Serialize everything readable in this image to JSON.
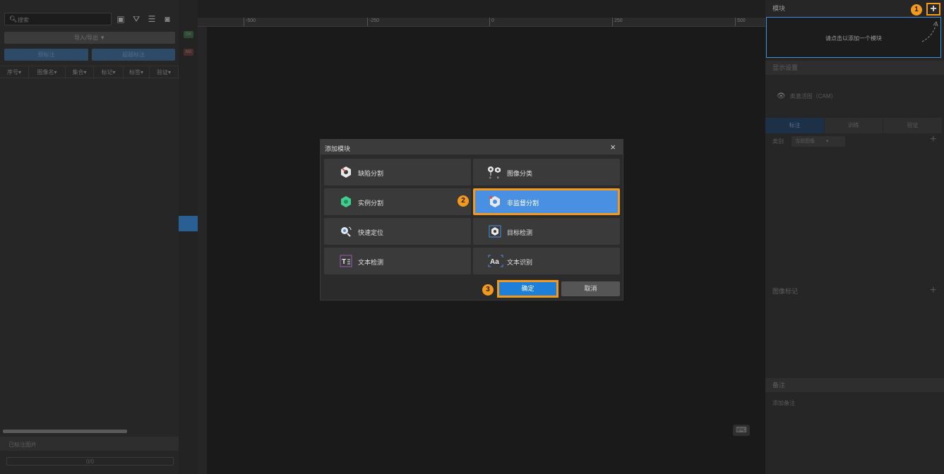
{
  "left_panel": {
    "search_placeholder": "搜索",
    "import_export": "导入/导出 ▼",
    "mode_a": "预标注",
    "mode_b": "超越标注",
    "columns": [
      "序号▾",
      "图像名▾",
      "集合▾",
      "标记▾",
      "标签▾",
      "验证▾"
    ],
    "labeled_images": "已标注图片",
    "progress": "0/0"
  },
  "ruler": {
    "ticks": [
      "-500",
      "-250",
      "0",
      "250",
      "500"
    ]
  },
  "gutter": {
    "ok": "OK",
    "ng": "NG"
  },
  "right_panel": {
    "module_title": "模块",
    "add_icon": "plus-icon",
    "module_hint": "请点击以添加一个模块",
    "display_settings": "显示设置",
    "view_label": "类激活图（CAM）",
    "tabs": [
      "标注",
      "训练",
      "验证"
    ],
    "class_label": "类别",
    "class_select": "当前图像",
    "image_marks": "图像标记",
    "notes": "备注",
    "notes_placeholder": "添加备注"
  },
  "dialog": {
    "title": "添加模块",
    "close": "×",
    "options": [
      {
        "label": "缺陷分割",
        "icon": "defect-segmentation-icon"
      },
      {
        "label": "图像分类",
        "icon": "image-classification-icon"
      },
      {
        "label": "实例分割",
        "icon": "instance-segmentation-icon"
      },
      {
        "label": "非监督分割",
        "icon": "unsupervised-segmentation-icon"
      },
      {
        "label": "快速定位",
        "icon": "fast-positioning-icon"
      },
      {
        "label": "目标检测",
        "icon": "object-detection-icon"
      },
      {
        "label": "文本检测",
        "icon": "text-detection-icon"
      },
      {
        "label": "文本识别",
        "icon": "text-recognition-icon"
      }
    ],
    "selected_index": 3,
    "ok": "确定",
    "cancel": "取消"
  },
  "callouts": [
    "1",
    "2",
    "3"
  ],
  "colors": {
    "accent_orange": "#f39a1c",
    "selection_blue": "#4a90e2",
    "ok_blue": "#1e7fd8"
  }
}
